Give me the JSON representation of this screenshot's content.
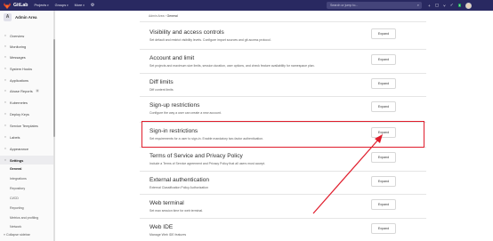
{
  "topbar": {
    "brand": "GitLab",
    "menus": [
      "Projects",
      "Groups",
      "More"
    ],
    "search_placeholder": "Search or jump to...",
    "badge": "1",
    "colors": {
      "bg": "#292961",
      "accent": "#e24329"
    }
  },
  "sidebar": {
    "header": "Admin Area",
    "items": [
      {
        "label": "Overview",
        "icon": "grid-icon"
      },
      {
        "label": "Monitoring",
        "icon": "monitor-icon"
      },
      {
        "label": "Messages",
        "icon": "message-icon"
      },
      {
        "label": "System Hooks",
        "icon": "hook-icon"
      },
      {
        "label": "Applications",
        "icon": "app-icon"
      },
      {
        "label": "Abuse Reports",
        "icon": "warning-icon",
        "badge": "0"
      },
      {
        "label": "Kubernetes",
        "icon": "cloud-icon"
      },
      {
        "label": "Deploy Keys",
        "icon": "key-icon"
      },
      {
        "label": "Service Templates",
        "icon": "template-icon"
      },
      {
        "label": "Labels",
        "icon": "label-icon"
      },
      {
        "label": "Appearance",
        "icon": "paint-icon"
      },
      {
        "label": "Settings",
        "icon": "gear-icon"
      }
    ],
    "sub_items": [
      "General",
      "Integrations",
      "Repository",
      "CI/CD",
      "Reporting",
      "Metrics and profiling",
      "Network"
    ],
    "collapse": "Collapse sidebar"
  },
  "breadcrumb": {
    "parent": "Admin Area",
    "sep": "›",
    "current": "General"
  },
  "sections": [
    {
      "title": "Visibility and access controls",
      "desc": "Set default and restrict visibility levels. Configure import sources and git access protocol.",
      "button": "Expand"
    },
    {
      "title": "Account and limit",
      "desc": "Set projects and maximum size limits, session duration, user options, and check feature availability for namespace plan.",
      "button": "Expand"
    },
    {
      "title": "Diff limits",
      "desc": "Diff content limits",
      "button": "Expand"
    },
    {
      "title": "Sign-up restrictions",
      "desc": "Configure the way a user can create a new account.",
      "button": "Expand"
    },
    {
      "title": "Sign-in restrictions",
      "desc": "Set requirements for a user to sign-in. Enable mandatory two-factor authentication.",
      "button": "Expand"
    },
    {
      "title": "Terms of Service and Privacy Policy",
      "desc": "Include a Terms of Service agreement and Privacy Policy that all users must accept.",
      "button": "Expand"
    },
    {
      "title": "External authentication",
      "desc": "External Classification Policy Authorization",
      "button": "Expand"
    },
    {
      "title": "Web terminal",
      "desc": "Set max session time for web terminal.",
      "button": "Expand"
    },
    {
      "title": "Web IDE",
      "desc": "Manage Web IDE features",
      "button": "Expand"
    }
  ],
  "annotation": {
    "color": "#e01c2b"
  }
}
